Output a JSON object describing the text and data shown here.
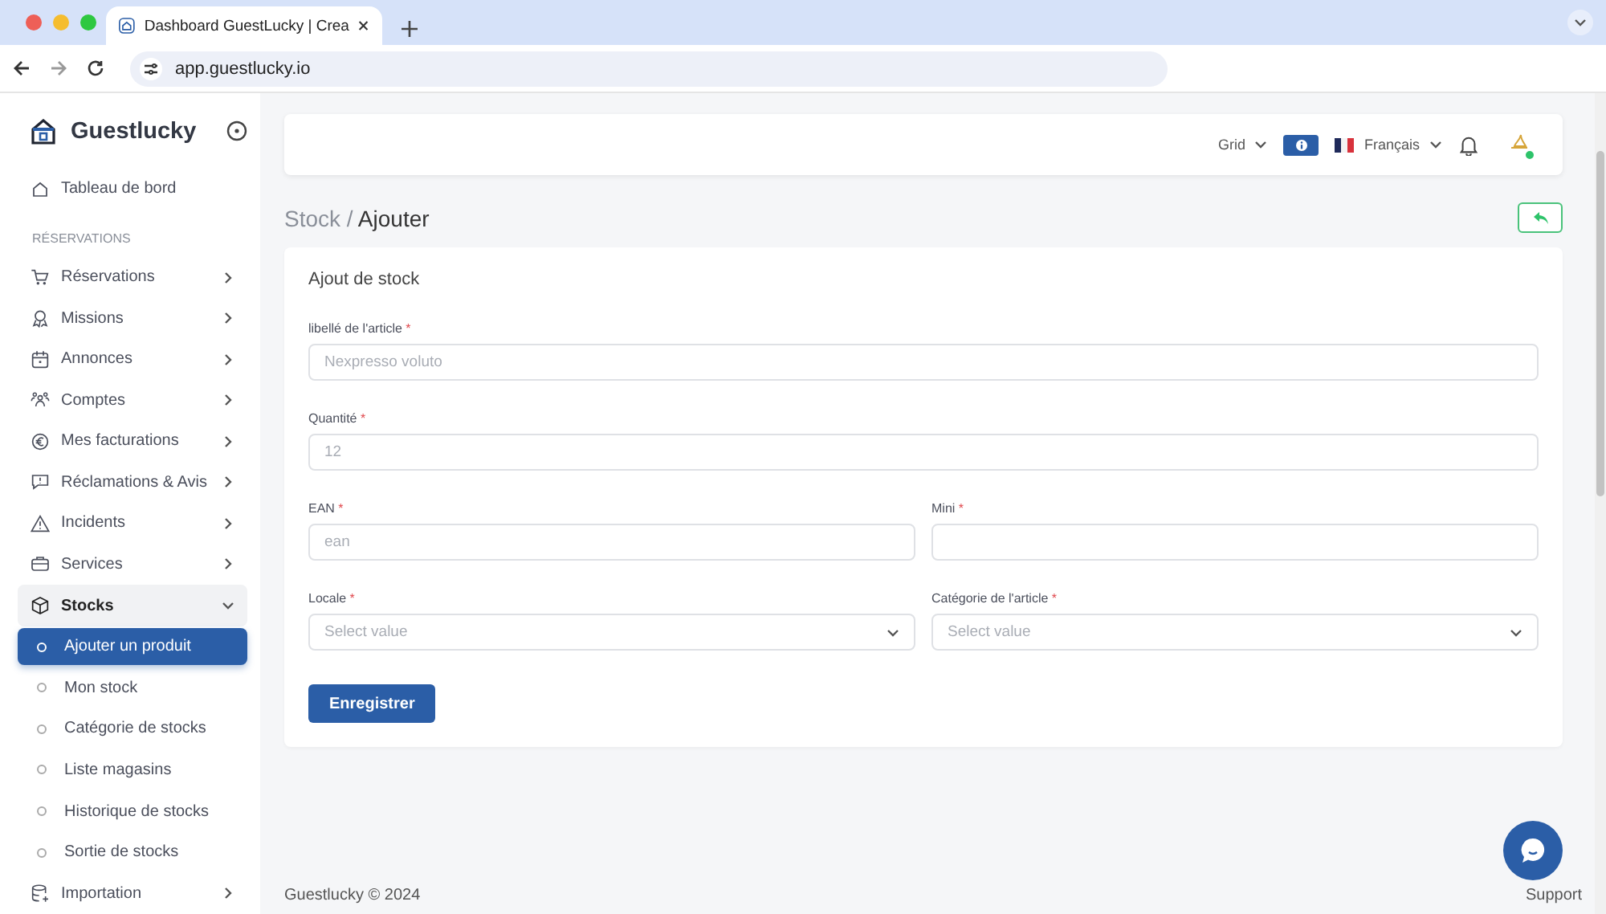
{
  "browser": {
    "tab_title": "Dashboard GuestLucky | Crea",
    "url": "app.guestlucky.io"
  },
  "sidebar": {
    "brand": "Guestlucky",
    "items": [
      {
        "kind": "link",
        "label": "Tableau de bord"
      },
      {
        "kind": "section",
        "label": "RÉSERVATIONS"
      },
      {
        "kind": "group",
        "label": "Réservations",
        "expanded": false
      },
      {
        "kind": "group",
        "label": "Missions",
        "expanded": false
      },
      {
        "kind": "group",
        "label": "Annonces",
        "expanded": false
      },
      {
        "kind": "group",
        "label": "Comptes",
        "expanded": false
      },
      {
        "kind": "group",
        "label": "Mes facturations",
        "expanded": false
      },
      {
        "kind": "group",
        "label": "Réclamations & Avis",
        "expanded": false
      },
      {
        "kind": "group",
        "label": "Incidents",
        "expanded": false
      },
      {
        "kind": "group",
        "label": "Services",
        "expanded": false
      },
      {
        "kind": "group",
        "label": "Stocks",
        "expanded": true,
        "children": [
          {
            "label": "Ajouter un produit",
            "selected": true
          },
          {
            "label": "Mon stock",
            "selected": false
          },
          {
            "label": "Catégorie de stocks",
            "selected": false
          },
          {
            "label": "Liste magasins",
            "selected": false
          },
          {
            "label": "Historique de stocks",
            "selected": false
          },
          {
            "label": "Sortie de stocks",
            "selected": false
          }
        ]
      },
      {
        "kind": "group",
        "label": "Importation",
        "expanded": false
      }
    ]
  },
  "topbar": {
    "layout": "Grid",
    "language": "Français"
  },
  "breadcrumb": {
    "parent": "Stock",
    "separator": "/",
    "current": "Ajouter"
  },
  "form": {
    "title": "Ajout de stock",
    "rows": [
      [
        {
          "kind": "text",
          "label": "libellé de l'article",
          "required_mark": "*",
          "placeholder": "Nexpresso voluto"
        }
      ],
      [
        {
          "kind": "text",
          "label": "Quantité",
          "required_mark": "*",
          "placeholder": "12"
        }
      ],
      [
        {
          "kind": "text",
          "label": "EAN",
          "required_mark": "*",
          "placeholder": "ean"
        },
        {
          "kind": "text",
          "label": "Mini",
          "required_mark": "*"
        }
      ],
      [
        {
          "kind": "select",
          "label": "Locale",
          "required_mark": "*",
          "placeholder": "Select value"
        },
        {
          "kind": "select",
          "label": "Catégorie de l'article",
          "required_mark": "*",
          "placeholder": "Select value"
        }
      ]
    ],
    "submit": "Enregistrer"
  },
  "footer": {
    "copyright": "Guestlucky © 2024",
    "link": "Support"
  }
}
